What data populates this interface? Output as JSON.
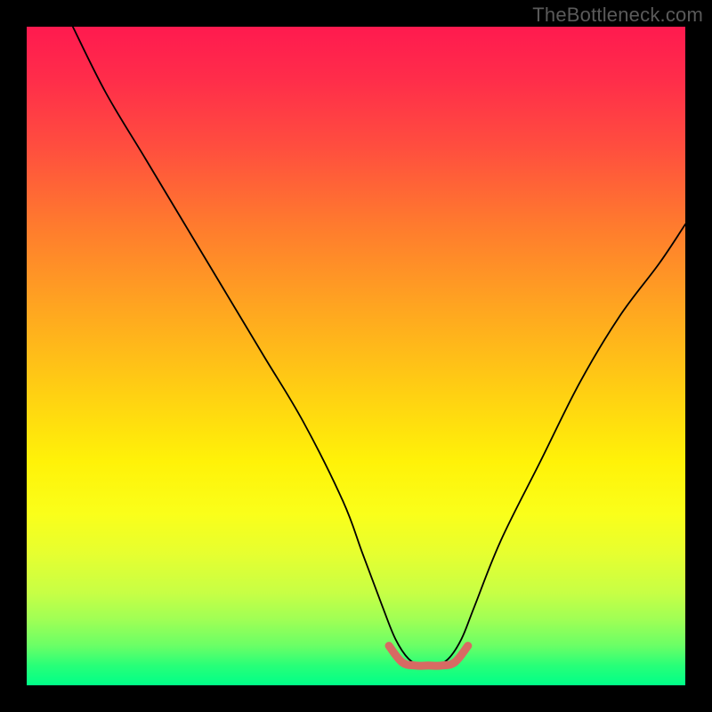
{
  "watermark": "TheBottleneck.com",
  "chart_data": {
    "type": "line",
    "title": "",
    "xlabel": "",
    "ylabel": "",
    "xlim": [
      0,
      100
    ],
    "ylim": [
      0,
      100
    ],
    "series": [
      {
        "name": "bottleneck-curve",
        "x": [
          7,
          12,
          18,
          24,
          30,
          36,
          42,
          48,
          51,
          54,
          56,
          58,
          60,
          62,
          64,
          66,
          68,
          72,
          78,
          84,
          90,
          96,
          100
        ],
        "y": [
          100,
          90,
          80,
          70,
          60,
          50,
          40,
          28,
          20,
          12,
          7,
          4,
          3,
          3,
          4,
          7,
          12,
          22,
          34,
          46,
          56,
          64,
          70
        ]
      }
    ],
    "annotations": [
      {
        "name": "bottom-highlight",
        "type": "segment",
        "color": "#d86a63",
        "x": [
          55,
          57,
          59,
          61,
          63,
          65,
          67
        ],
        "y": [
          6,
          3.5,
          3,
          3,
          3,
          3.5,
          6
        ]
      }
    ],
    "background_gradient": {
      "top": "#ff1a4f",
      "mid": "#fff208",
      "bottom": "#00ff88"
    }
  }
}
